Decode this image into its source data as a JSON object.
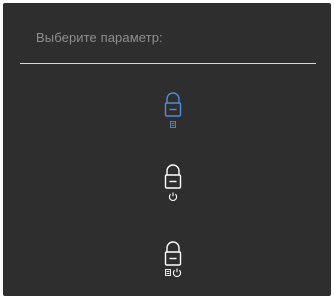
{
  "menu": {
    "prompt": "Выберите параметр:",
    "options": [
      {
        "name": "lock-menu-buttons",
        "icons": [
          "lock-icon",
          "menu-buttons-icon"
        ],
        "selected": true
      },
      {
        "name": "lock-power-button",
        "icons": [
          "lock-icon",
          "power-icon"
        ],
        "selected": false
      },
      {
        "name": "lock-menu-and-power-buttons",
        "icons": [
          "lock-icon",
          "menu-buttons-icon",
          "power-icon"
        ],
        "selected": false
      }
    ]
  },
  "colors": {
    "background": "#2e2e2e",
    "prompt_text": "#8f8f8f",
    "divider": "#d8d8d8",
    "selected_icon": "#4a8fd9",
    "icon": "#ffffff"
  }
}
